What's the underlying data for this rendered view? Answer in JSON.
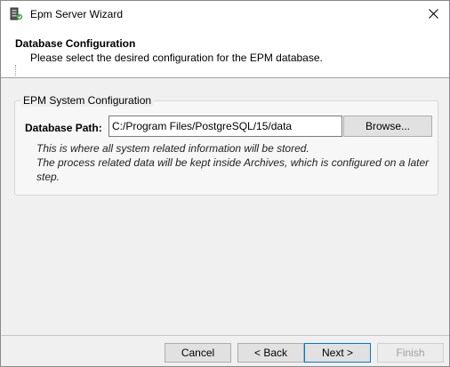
{
  "window": {
    "title": "Epm Server Wizard"
  },
  "header": {
    "title": "Database Configuration",
    "subtitle": "Please select the desired configuration for the EPM database."
  },
  "group": {
    "legend": "EPM System Configuration",
    "database_path_label": "Database Path:",
    "database_path_value": "C:/Program Files/PostgreSQL/15/data",
    "browse_label": "Browse...",
    "hint_line1": "This is where all system related information will be stored.",
    "hint_line2": "The process related data will be kept inside Archives, which is configured on a later",
    "hint_line3": "step."
  },
  "footer": {
    "cancel_label": "Cancel",
    "back_label": "< Back",
    "next_label": "Next >",
    "finish_label": "Finish"
  },
  "icons": {
    "app": "server-wizard-icon",
    "close": "close-icon"
  }
}
